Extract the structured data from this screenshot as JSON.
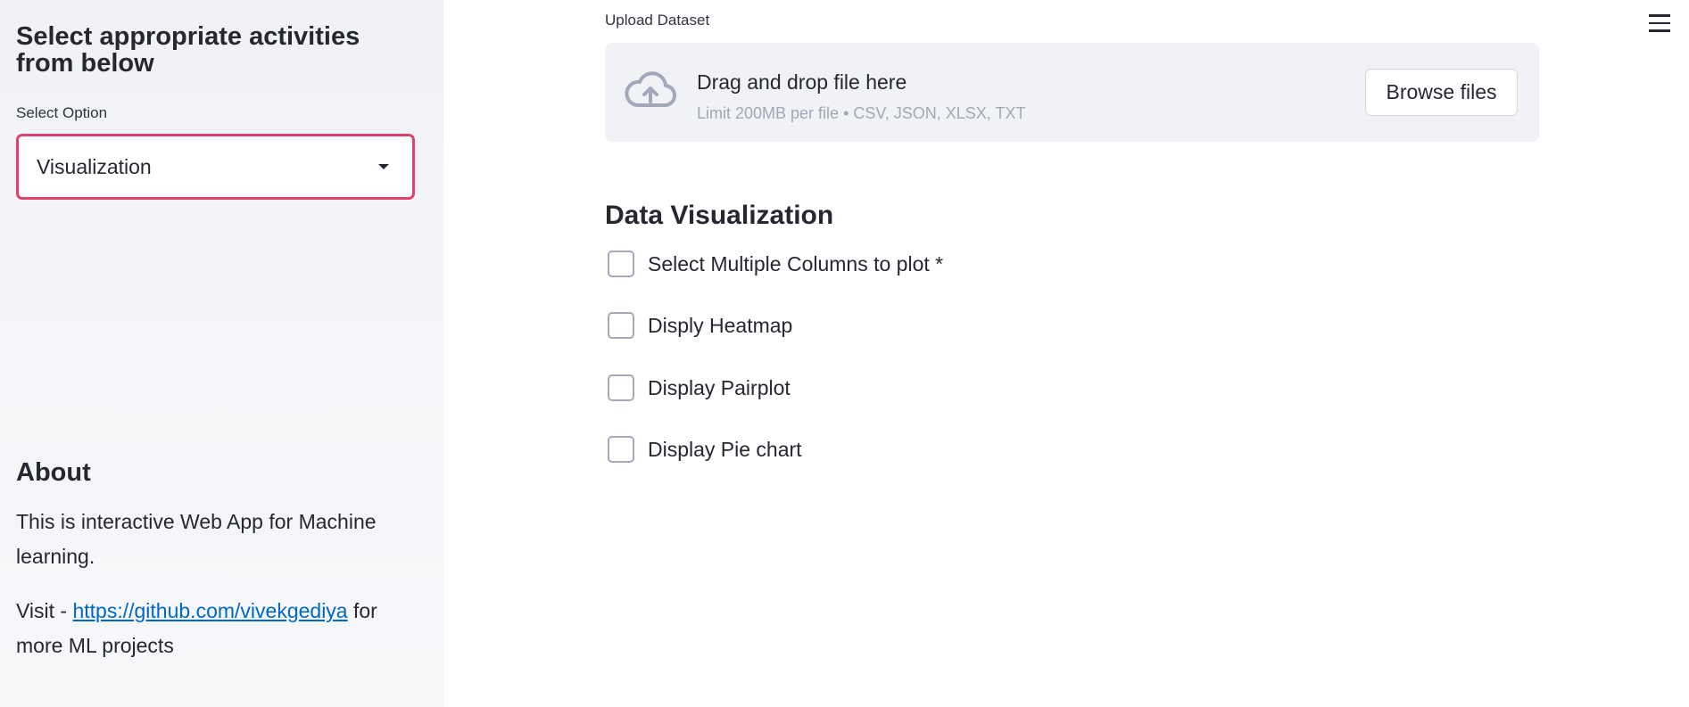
{
  "sidebar": {
    "title": "Select appropriate activities from below",
    "select_label": "Select Option",
    "select_value": "Visualization",
    "about_heading": "About",
    "about_text": "This is interactive Web App for Machine learning.",
    "visit_prefix": "Visit - ",
    "visit_link": "https://github.com/vivekgediya",
    "visit_suffix": " for more ML projects"
  },
  "upload": {
    "label": "Upload Dataset",
    "drag_text": "Drag and drop file here",
    "limit_text": "Limit 200MB per file • CSV, JSON, XLSX, TXT",
    "browse_label": "Browse files",
    "icon": "cloud-upload-icon"
  },
  "main": {
    "section_title": "Data Visualization",
    "checkboxes": [
      {
        "label": "Select Multiple Columns to plot *",
        "checked": false
      },
      {
        "label": "Disply Heatmap",
        "checked": false
      },
      {
        "label": "Display Pairplot",
        "checked": false
      },
      {
        "label": "Display Pie chart",
        "checked": false
      }
    ]
  },
  "menu_icon": "hamburger-menu-icon",
  "colors": {
    "accent": "#e2416b",
    "link": "#0068c9",
    "sidebar_bg": "#f0f2f6",
    "text": "#262730"
  }
}
